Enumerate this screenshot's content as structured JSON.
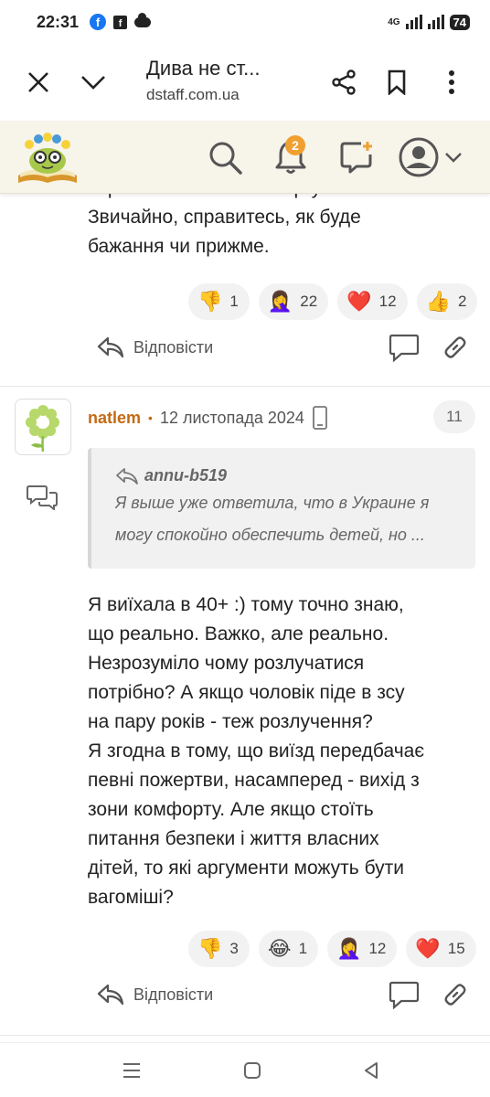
{
  "status_bar": {
    "time": "22:31",
    "network": "4G",
    "battery": "74"
  },
  "browser": {
    "title": "Дива не ст...",
    "url": "dstaff.com.ua"
  },
  "header": {
    "notifications_count": "2"
  },
  "previous_comment": {
    "text_lines": [
      "справлюсь - точно не аргумент.",
      "Звичайно, справитесь, як буде",
      "бажання чи прижме."
    ],
    "reactions": [
      {
        "emoji": "👎",
        "count": "1"
      },
      {
        "emoji": "🤦‍♀️",
        "count": "22"
      },
      {
        "emoji": "❤️",
        "count": "12"
      },
      {
        "emoji": "👍",
        "count": "2"
      }
    ],
    "reply_label": "Відповісти"
  },
  "comment": {
    "author": "natlem",
    "date": "12 листопада 2024",
    "number": "11",
    "quote": {
      "author": "annu-b519",
      "lines": [
        "Я выше уже ответила, что в Украине я",
        "могу спокойно обеспечить детей, но ..."
      ]
    },
    "text_lines": [
      "Я виїхала в 40+ :) тому точно знаю,",
      "що реально. Важко, але реально.",
      "Незрозуміло чому розлучатися",
      "потрібно? А якщо чоловік піде в зсу",
      "на пару років - теж розлучення?",
      "Я згодна в тому, що виїзд передбачає",
      "певні пожертви, насамперед - вихід з",
      "зони комфорту. Але якщо стоїть",
      "питання безпеки і життя власних",
      "дітей, то які аргументи можуть бути",
      "вагоміші?"
    ],
    "reactions": [
      {
        "emoji": "👎",
        "count": "3"
      },
      {
        "emoji": "😂",
        "count": "1"
      },
      {
        "emoji": "🤦‍♀️",
        "count": "12"
      },
      {
        "emoji": "❤️",
        "count": "15"
      }
    ],
    "reply_label": "Відповісти"
  }
}
